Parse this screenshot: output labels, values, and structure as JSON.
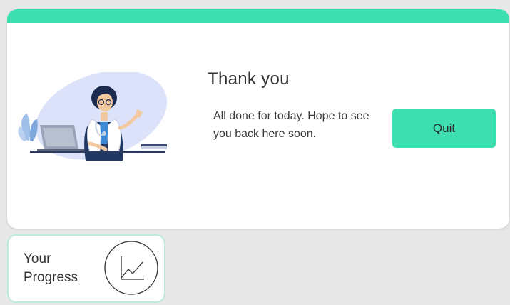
{
  "screen": {
    "title": "Thank you",
    "message": "All done for today. Hope to see you back here soon.",
    "quit_label": "Quit"
  },
  "progress_card": {
    "label": "Your Progress",
    "icon": "line-chart-icon"
  },
  "colors": {
    "accent": "#3ee0b2",
    "background": "#e6e7e6",
    "card": "#ffffff",
    "text": "#333333"
  }
}
